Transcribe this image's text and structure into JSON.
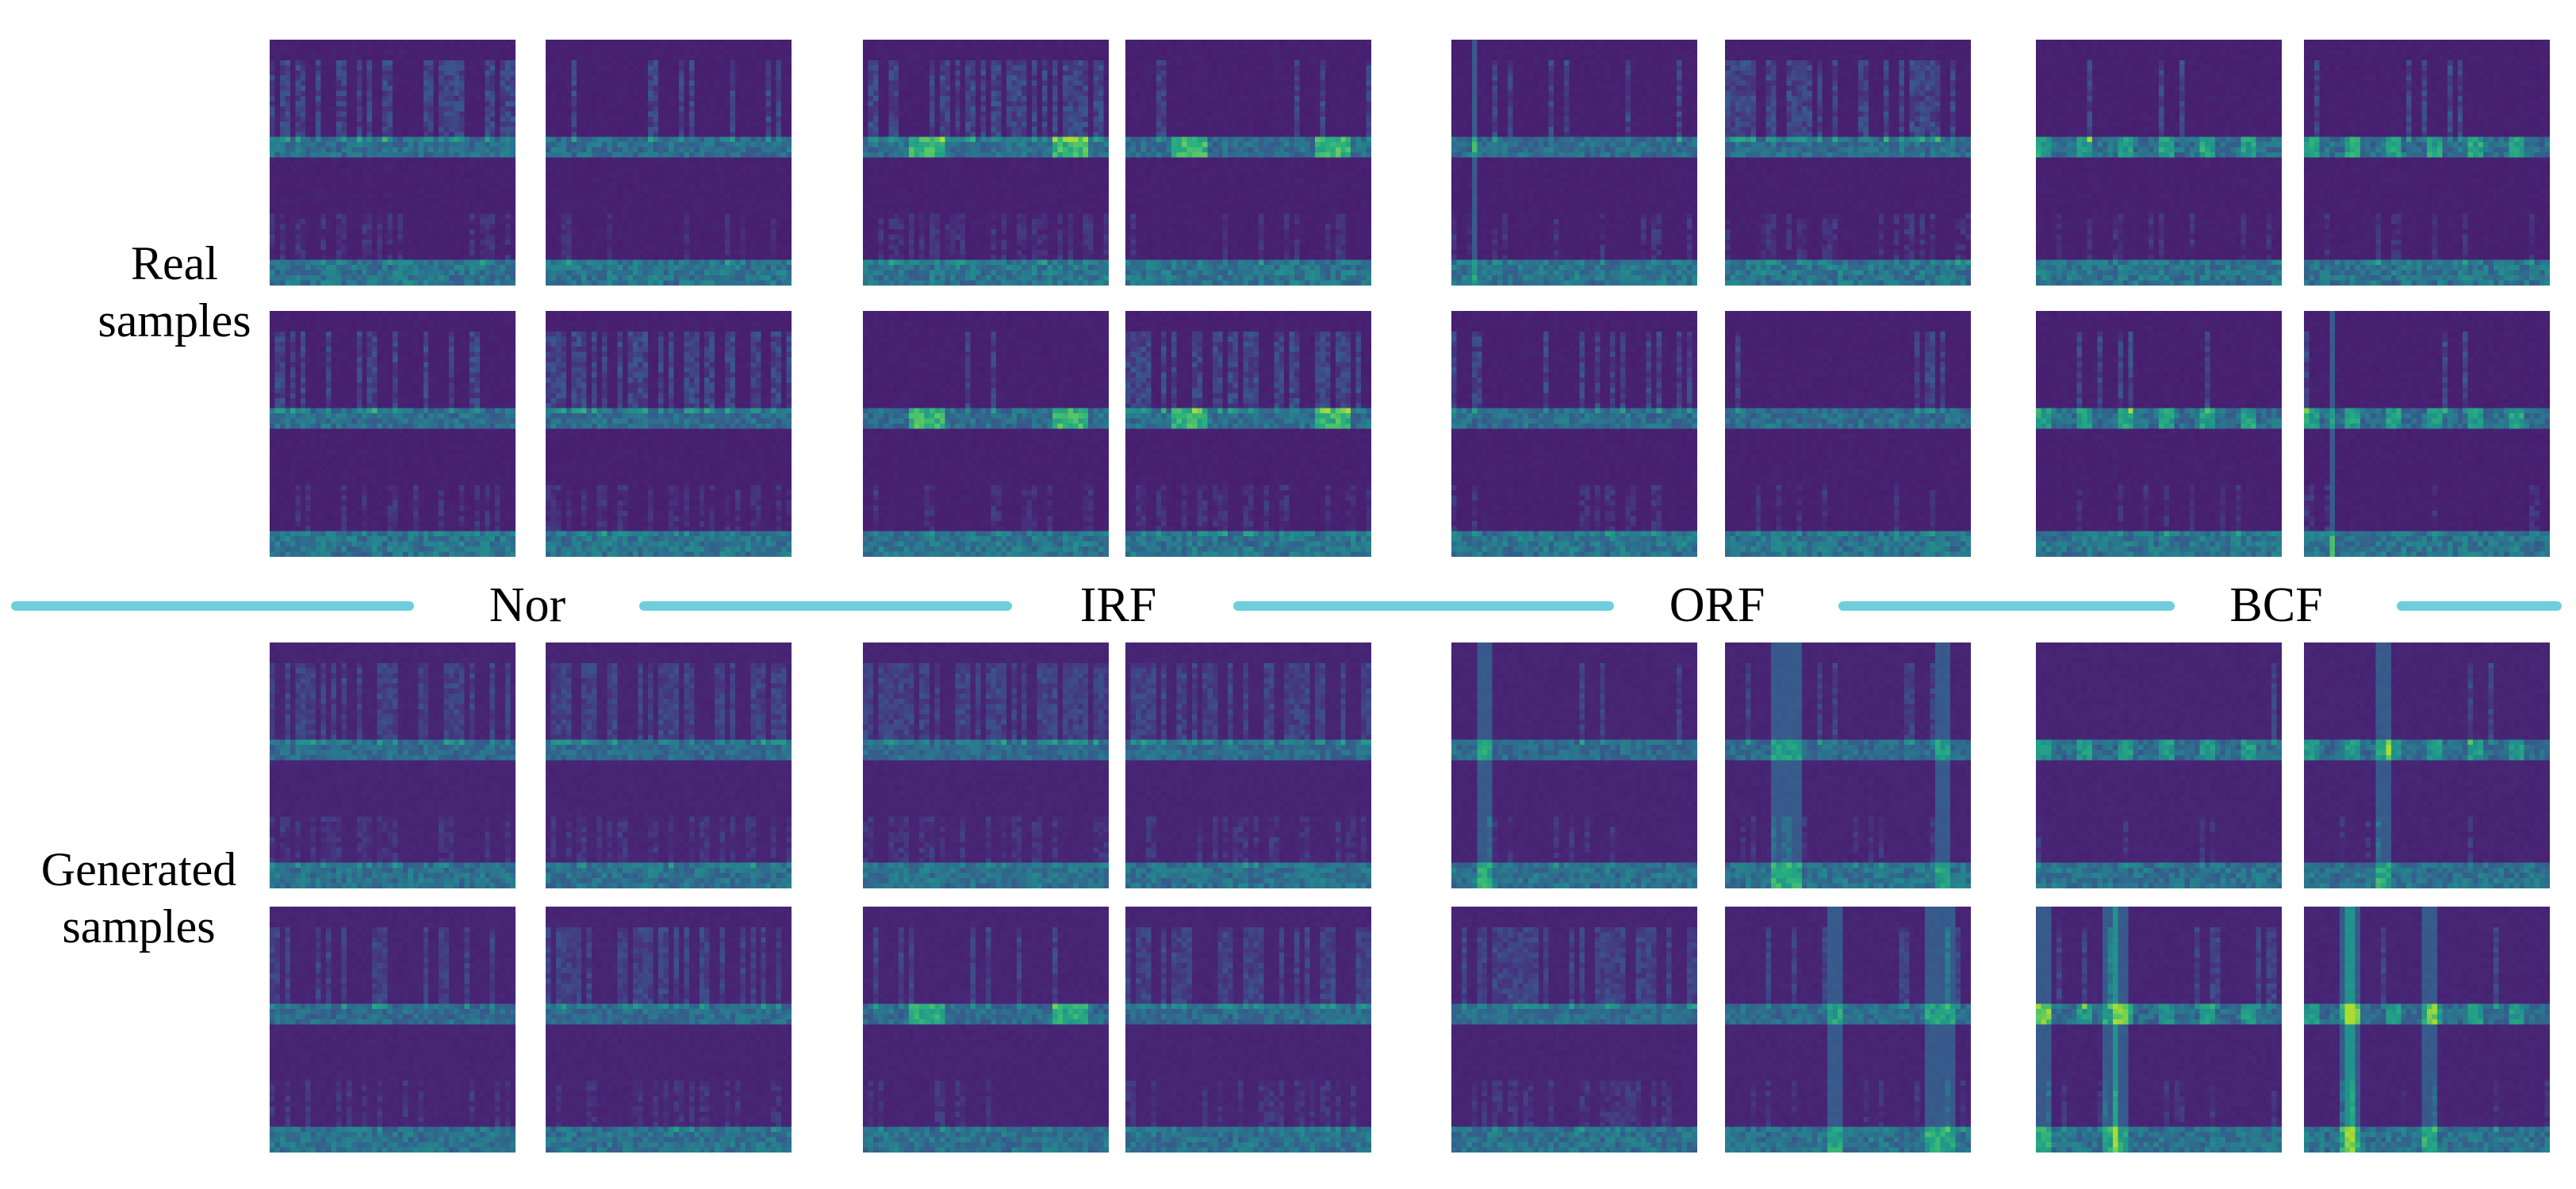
{
  "row_labels": {
    "real": [
      "Real",
      "samples"
    ],
    "generated": [
      "Generated",
      "samples"
    ]
  },
  "classes": [
    {
      "id": "nor",
      "label": "Nor"
    },
    {
      "id": "irf",
      "label": "IRF"
    },
    {
      "id": "orf",
      "label": "ORF"
    },
    {
      "id": "bcf",
      "label": "BCF"
    }
  ],
  "colors": {
    "divider": "#70cedc",
    "colormap": "viridis"
  },
  "sections": [
    {
      "id": "real",
      "tiles_per_class": 4
    },
    {
      "id": "generated",
      "tiles_per_class": 4
    }
  ],
  "tile_features": {
    "real": {
      "nor": [
        "dense-upper",
        "sparse",
        "sparse",
        "dense-upper"
      ],
      "irf": [
        "dense-upper-peaks",
        "peaks",
        "faint-peaks",
        "dense-upper-peaks"
      ],
      "orf": [
        "vertical-streak",
        "dense-upper",
        "sparse-upper",
        "faint"
      ],
      "bcf": [
        "periodic",
        "periodic",
        "periodic",
        "periodic-streak"
      ]
    },
    "generated": {
      "nor": [
        "smooth-dense",
        "smooth-dense",
        "smooth-sparse",
        "smooth-dense"
      ],
      "irf": [
        "smooth-dense",
        "smooth-dense",
        "faint-peaks",
        "smooth-dense"
      ],
      "orf": [
        "vertical-streak",
        "vertical-streaks",
        "smooth-dense",
        "vertical-streaks"
      ],
      "bcf": [
        "periodic",
        "periodic-streak",
        "periodic-streaks",
        "periodic-streaks"
      ]
    }
  }
}
